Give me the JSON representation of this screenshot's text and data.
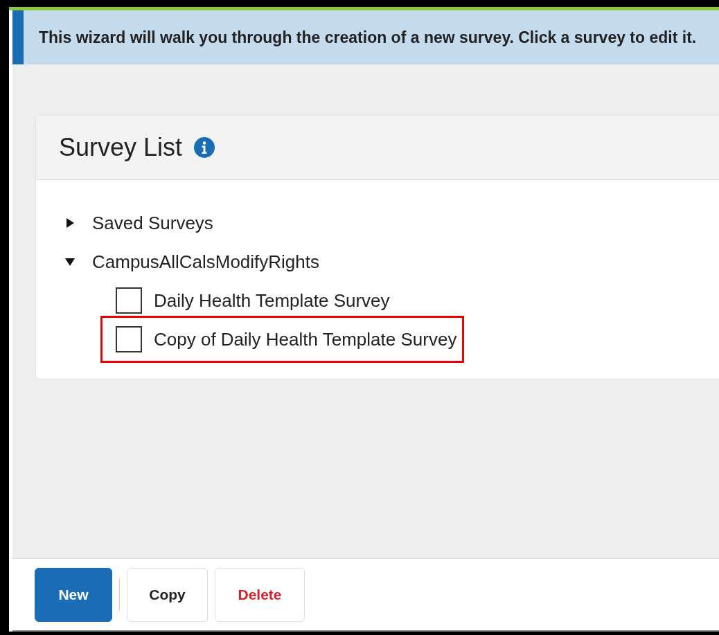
{
  "banner": {
    "text": "This wizard will walk you through the creation of a new survey. Click a survey to edit it."
  },
  "panel": {
    "title": "Survey List",
    "tree": [
      {
        "label": "Saved Surveys",
        "expanded": false
      },
      {
        "label": "CampusAllCalsModifyRights",
        "expanded": true,
        "children": [
          {
            "label": "Daily Health Template Survey",
            "checked": false,
            "highlighted": false
          },
          {
            "label": "Copy of Daily Health Template Survey",
            "checked": false,
            "highlighted": true
          }
        ]
      }
    ]
  },
  "buttons": [
    {
      "label": "New",
      "kind": "primary"
    },
    {
      "label": "Copy",
      "kind": "default"
    },
    {
      "label": "Delete",
      "kind": "danger"
    }
  ]
}
